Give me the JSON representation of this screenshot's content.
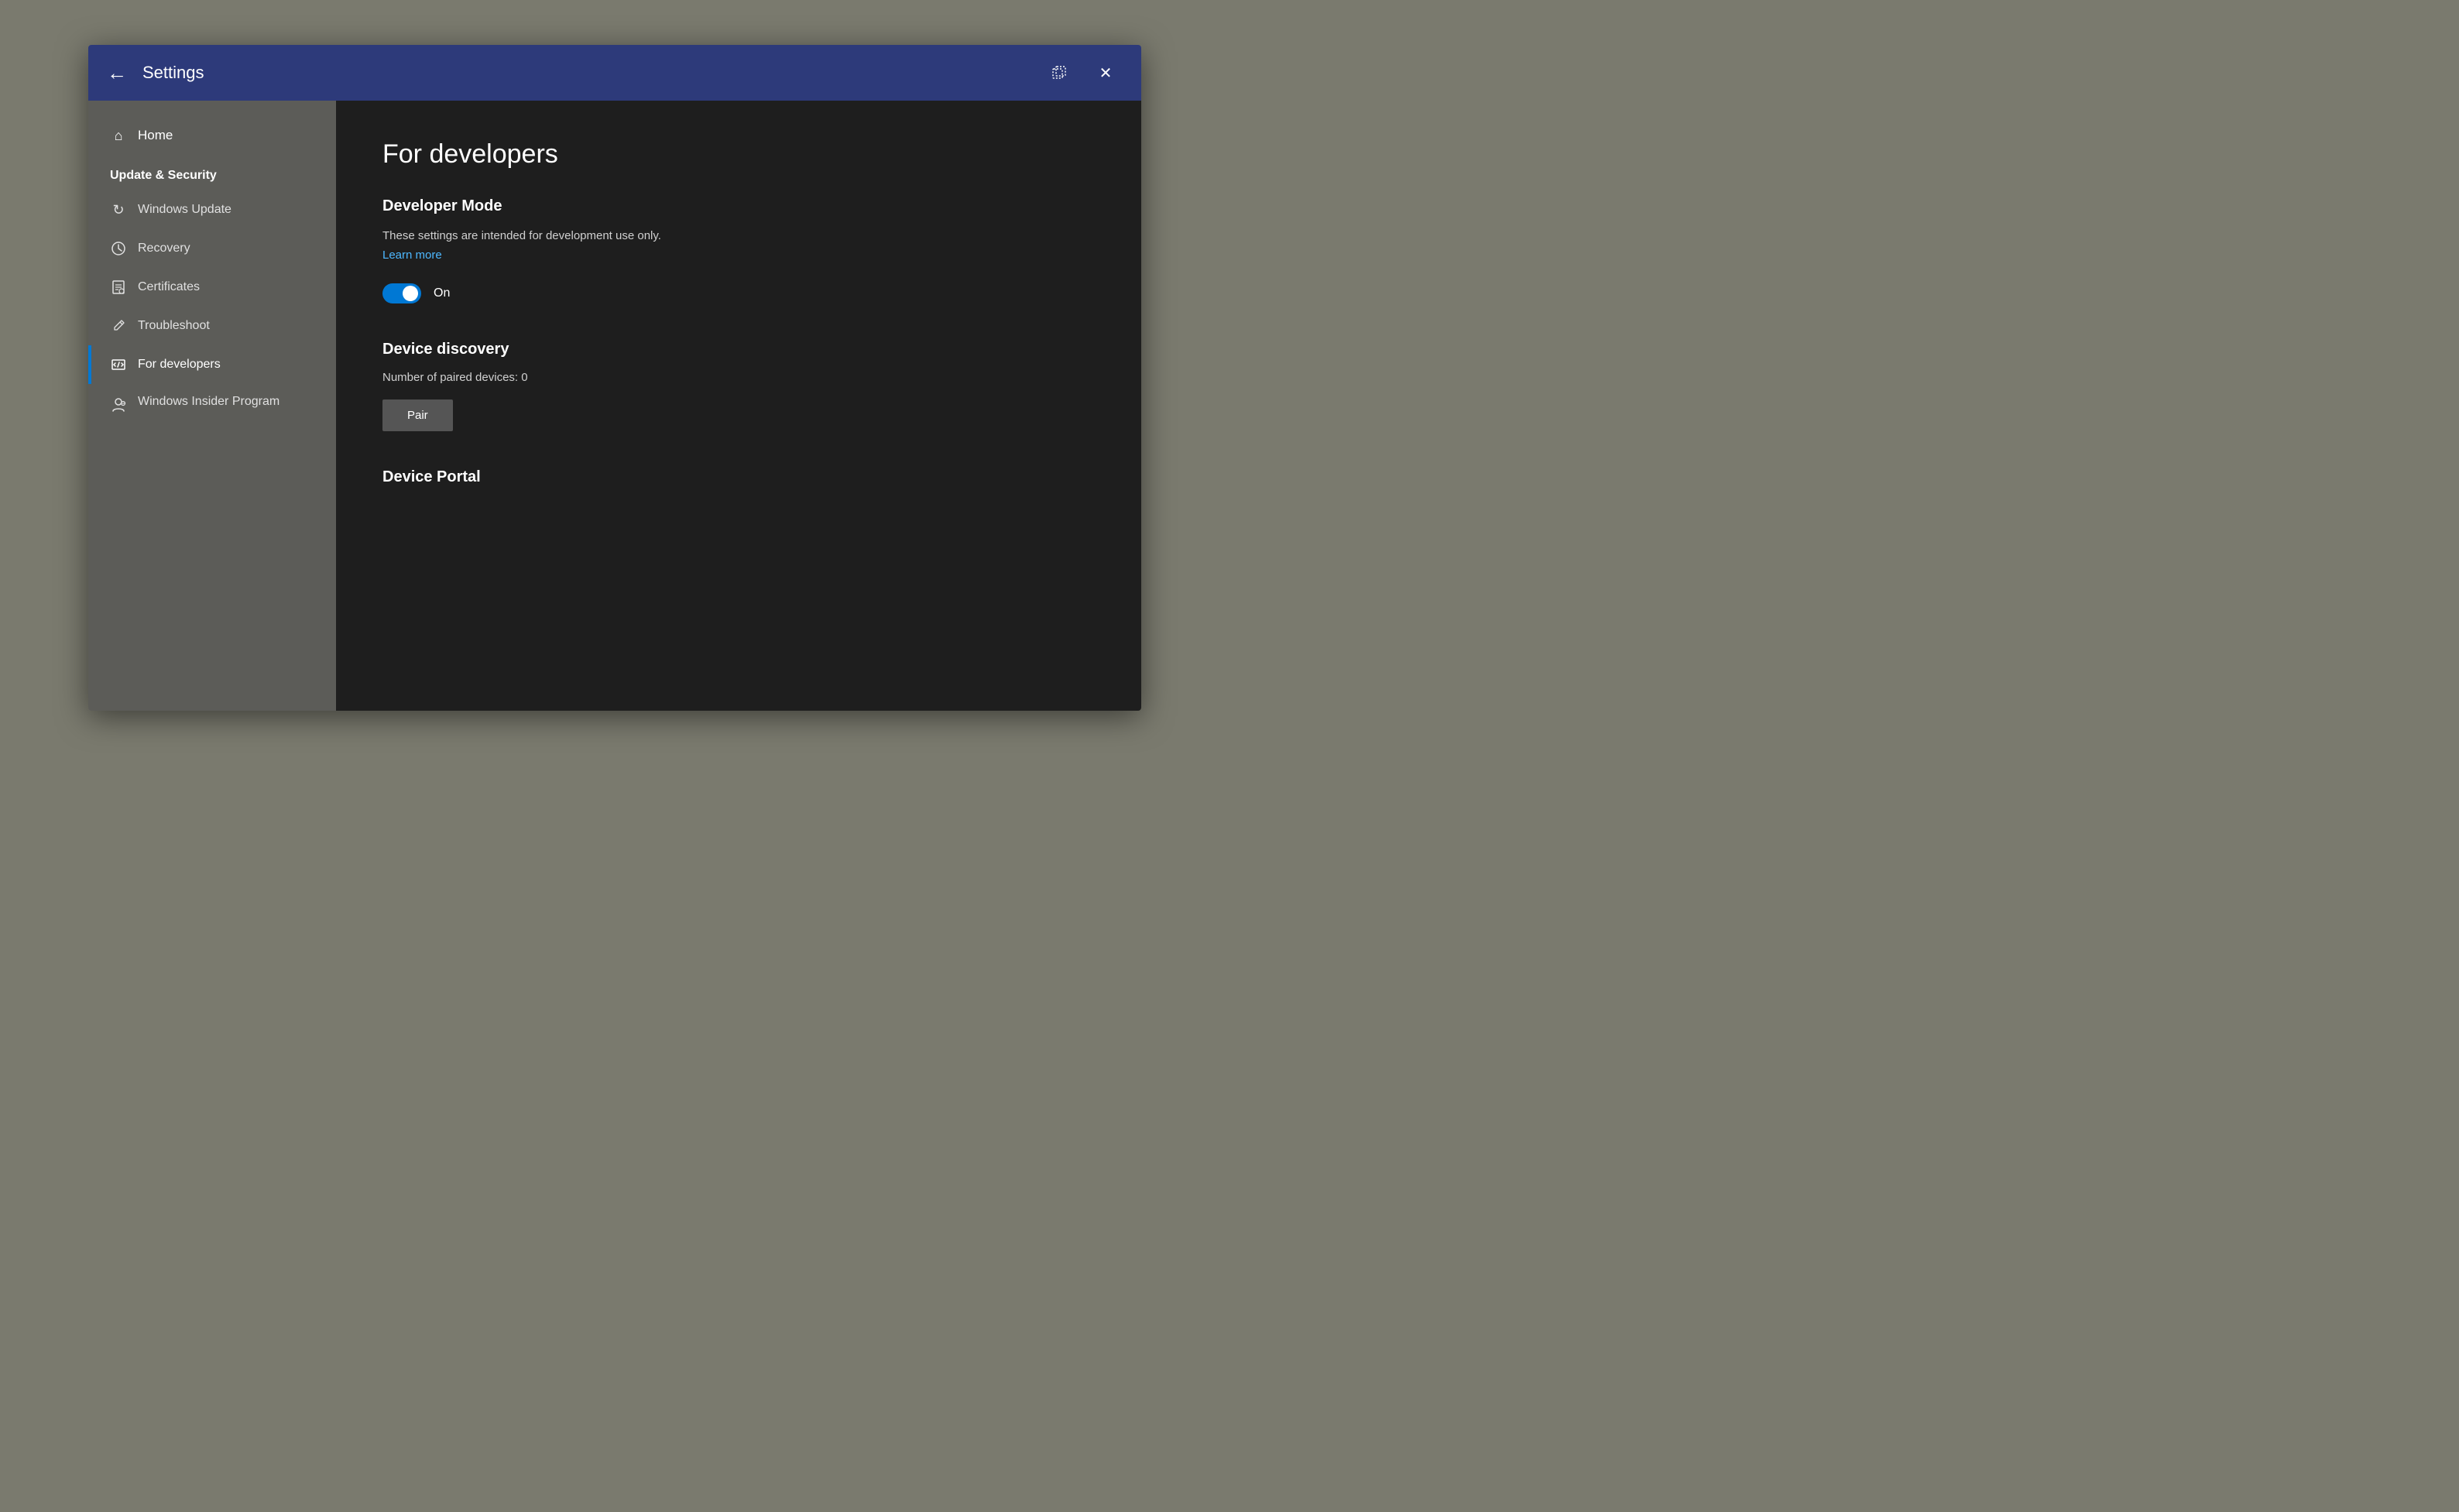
{
  "titlebar": {
    "back_label": "←",
    "title": "Settings",
    "restore_icon": "restore-icon",
    "close_label": "✕"
  },
  "sidebar": {
    "home_label": "Home",
    "section_title": "Update & Security",
    "items": [
      {
        "id": "windows-update",
        "label": "Windows Update",
        "icon": "↻"
      },
      {
        "id": "recovery",
        "label": "Recovery",
        "icon": "⏱"
      },
      {
        "id": "certificates",
        "label": "Certificates",
        "icon": "🖹"
      },
      {
        "id": "troubleshoot",
        "label": "Troubleshoot",
        "icon": "🔧"
      },
      {
        "id": "for-developers",
        "label": "For developers",
        "icon": "⊞",
        "active": true
      },
      {
        "id": "windows-insider",
        "label": "Windows Insider Program",
        "icon": "👤"
      }
    ]
  },
  "main": {
    "page_title": "For developers",
    "developer_mode": {
      "section_title": "Developer Mode",
      "description": "These settings are intended for development use only.",
      "learn_more_label": "Learn more",
      "toggle_state": "On"
    },
    "device_discovery": {
      "section_title": "Device discovery",
      "paired_devices_label": "Number of paired devices: 0",
      "pair_button_label": "Pair"
    },
    "device_portal": {
      "section_title": "Device Portal"
    }
  }
}
